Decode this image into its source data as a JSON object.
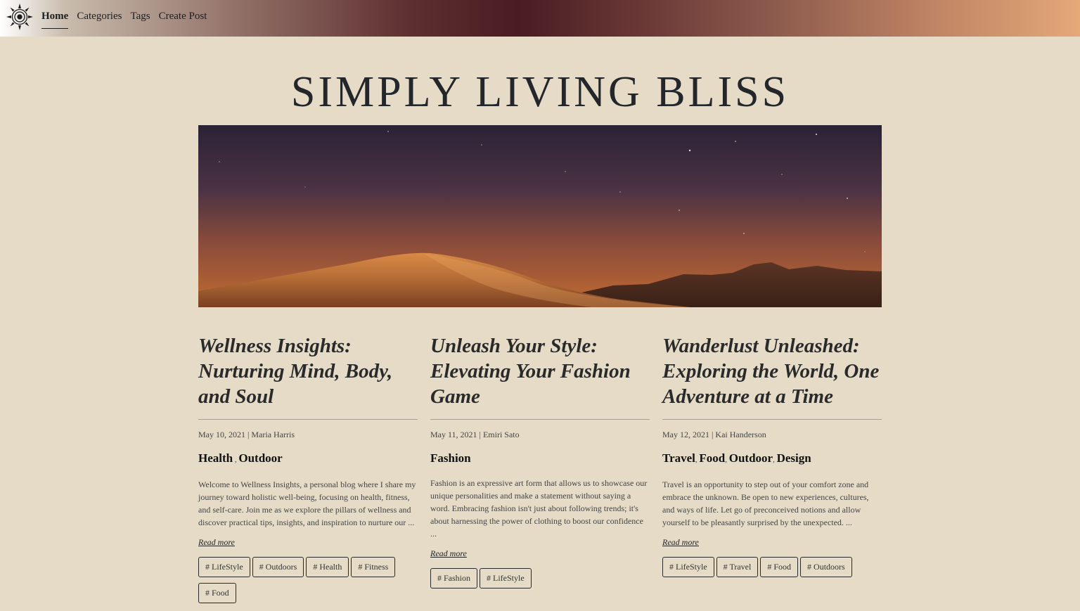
{
  "nav": {
    "logo_icon": "sun-ornament-icon",
    "links": [
      {
        "label": "Home",
        "active": true
      },
      {
        "label": "Categories",
        "active": false
      },
      {
        "label": "Tags",
        "active": false
      },
      {
        "label": "Create Post",
        "active": false
      }
    ]
  },
  "site": {
    "title": "SIMPLY LIVING BLISS"
  },
  "hero": {
    "image": "desert-dune-starry-night"
  },
  "posts": [
    {
      "title": "Wellness Insights: Nurturing Mind, Body, and Soul",
      "meta": "May 10, 2021 | Maria Harris",
      "categories": [
        "Health",
        "Outdoor"
      ],
      "excerpt": "Welcome to Wellness Insights, a personal blog where I share my journey toward holistic well-being, focusing on health, fitness, and self-care. Join me as we explore the pillars of wellness and discover practical tips, insights, and inspiration to nurture our ...",
      "read_more": "Read more",
      "tags": [
        "# LifeStyle",
        "# Outdoors",
        "# Health",
        "# Fitness",
        "# Food"
      ]
    },
    {
      "title": "Unleash Your Style: Elevating Your Fashion Game",
      "meta": "May 11, 2021 | Emiri Sato",
      "categories": [
        "Fashion"
      ],
      "excerpt": "Fashion is an expressive art form that allows us to showcase our unique personalities and make a statement without saying a word. Embracing fashion isn't just about following trends; it's about harnessing the power of clothing to boost our confidence ...",
      "read_more": "Read more",
      "tags": [
        "# Fashion",
        "# LifeStyle"
      ]
    },
    {
      "title": "Wanderlust Unleashed: Exploring the World, One Adventure at a Time",
      "meta": "May 12, 2021 | Kai Handerson",
      "categories": [
        "Travel",
        "Food",
        "Outdoor",
        "Design"
      ],
      "excerpt": "Travel is an opportunity to step out of your comfort zone and embrace the unknown. Be open to new experiences, cultures, and ways of life. Let go of preconceived notions and allow yourself to be pleasantly surprised by the unexpected. ...",
      "read_more": "Read more",
      "tags": [
        "# LifeStyle",
        "# Travel",
        "# Food",
        "# Outdoors"
      ]
    }
  ]
}
